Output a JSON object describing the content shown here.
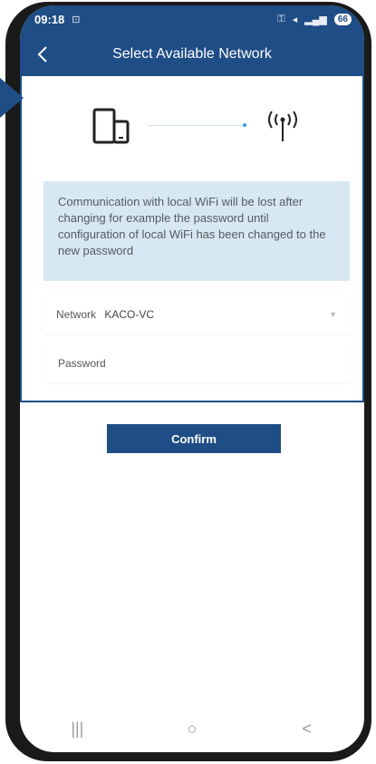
{
  "status_bar": {
    "time": "09:18",
    "battery": "66"
  },
  "header": {
    "title": "Select Available Network"
  },
  "info": {
    "message": "Communication with local WiFi will be lost after changing for example the password until configuration of local WiFi has been changed to the new password"
  },
  "network": {
    "label": "Network",
    "value": "KACO-VC"
  },
  "password": {
    "placeholder": "Password"
  },
  "confirm": {
    "label": "Confirm"
  },
  "nav": {
    "recent_glyph": "|||",
    "home_glyph": "○",
    "back_glyph": "<"
  },
  "colors": {
    "brand": "#1f4d86",
    "info_bg": "#d8e8f3"
  }
}
